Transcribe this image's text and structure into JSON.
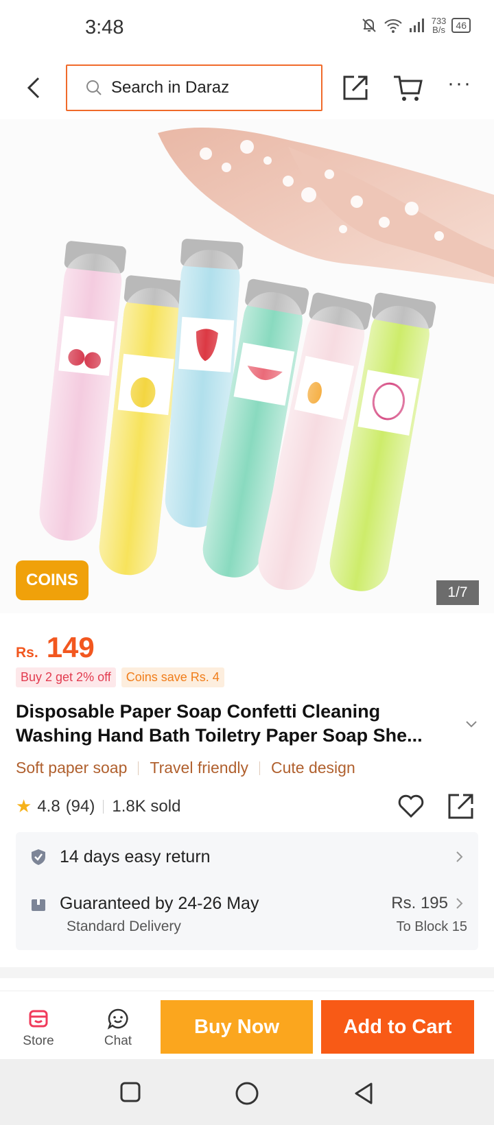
{
  "status": {
    "time": "3:48",
    "net_speed_value": "733",
    "net_speed_unit": "B/s",
    "battery": "46"
  },
  "topbar": {
    "search_placeholder": "Search in Daraz"
  },
  "gallery": {
    "coins_badge": "COINS",
    "counter": "1/7"
  },
  "product": {
    "currency": "Rs.",
    "price": "149",
    "promos": [
      "Buy 2 get 2% off",
      "Coins save Rs. 4"
    ],
    "title": "Disposable Paper Soap Confetti Cleaning Washing Hand Bath Toiletry Paper Soap She...",
    "tags": [
      "Soft paper soap",
      "Travel friendly",
      "Cute design"
    ],
    "rating": "4.8",
    "reviews": "(94)",
    "sold": "1.8K sold",
    "labels_on_bottles": [
      "Cherry",
      "Pear",
      "Pitaya"
    ]
  },
  "service": {
    "return_label": "14 days easy return",
    "delivery_label": "Guaranteed by 24-26 May",
    "delivery_type": "Standard Delivery",
    "delivery_fee": "Rs. 195",
    "delivery_dest": "To Block 15"
  },
  "actions": {
    "store": "Store",
    "chat": "Chat",
    "buy_now": "Buy Now",
    "add_to_cart": "Add to Cart"
  },
  "colors": {
    "accent": "#f85a16",
    "buy_now": "#fba61e",
    "price": "#f2571f",
    "coins": "#f0a10a"
  }
}
